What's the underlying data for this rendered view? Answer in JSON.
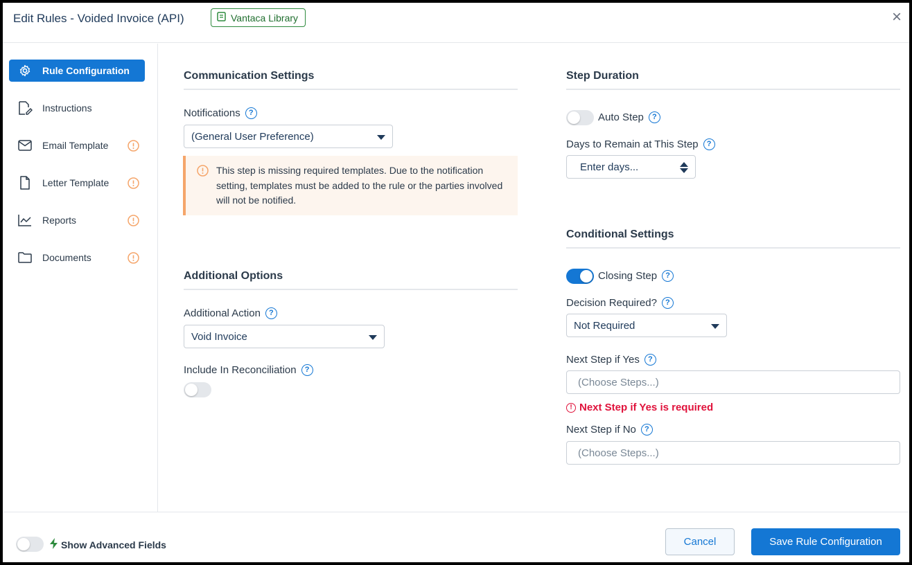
{
  "header": {
    "title": "Edit Rules - Voided Invoice (API)",
    "library_badge": "Vantaca Library",
    "close_glyph": "×"
  },
  "sidebar": {
    "items": [
      {
        "label": "Rule Configuration",
        "icon": "gear-icon",
        "active": true,
        "warning": false
      },
      {
        "label": "Instructions",
        "icon": "edit-document-icon",
        "active": false,
        "warning": false
      },
      {
        "label": "Email Template",
        "icon": "envelope-icon",
        "active": false,
        "warning": true
      },
      {
        "label": "Letter Template",
        "icon": "file-icon",
        "active": false,
        "warning": true
      },
      {
        "label": "Reports",
        "icon": "line-chart-icon",
        "active": false,
        "warning": true
      },
      {
        "label": "Documents",
        "icon": "folder-icon",
        "active": false,
        "warning": true
      }
    ]
  },
  "communication": {
    "title": "Communication Settings",
    "notifications_label": "Notifications",
    "notifications_value": "(General User Preference)",
    "alert_text": "This step is missing required templates. Due to the notification setting, templates must be added to the rule or the parties involved will not be notified."
  },
  "additional": {
    "title": "Additional Options",
    "action_label": "Additional Action",
    "action_value": "Void Invoice",
    "reconciliation_label": "Include In Reconciliation",
    "reconciliation_on": false
  },
  "duration": {
    "title": "Step Duration",
    "auto_step_label": "Auto Step",
    "auto_step_on": false,
    "days_label": "Days to Remain at This Step",
    "days_placeholder": "Enter days..."
  },
  "conditional": {
    "title": "Conditional Settings",
    "closing_step_label": "Closing Step",
    "closing_step_on": true,
    "decision_label": "Decision Required?",
    "decision_value": "Not Required",
    "next_yes_label": "Next Step if Yes",
    "next_yes_placeholder": "(Choose Steps...)",
    "next_yes_error": "Next Step if Yes is required",
    "next_no_label": "Next Step if No",
    "next_no_placeholder": "(Choose Steps...)"
  },
  "footer": {
    "advanced_label": "Show Advanced Fields",
    "advanced_on": false,
    "cancel_label": "Cancel",
    "save_label": "Save Rule Configuration"
  },
  "colors": {
    "accent": "#1477d4",
    "warning": "#f5a56a",
    "error": "#e0123b",
    "success": "#2e8b3e"
  }
}
